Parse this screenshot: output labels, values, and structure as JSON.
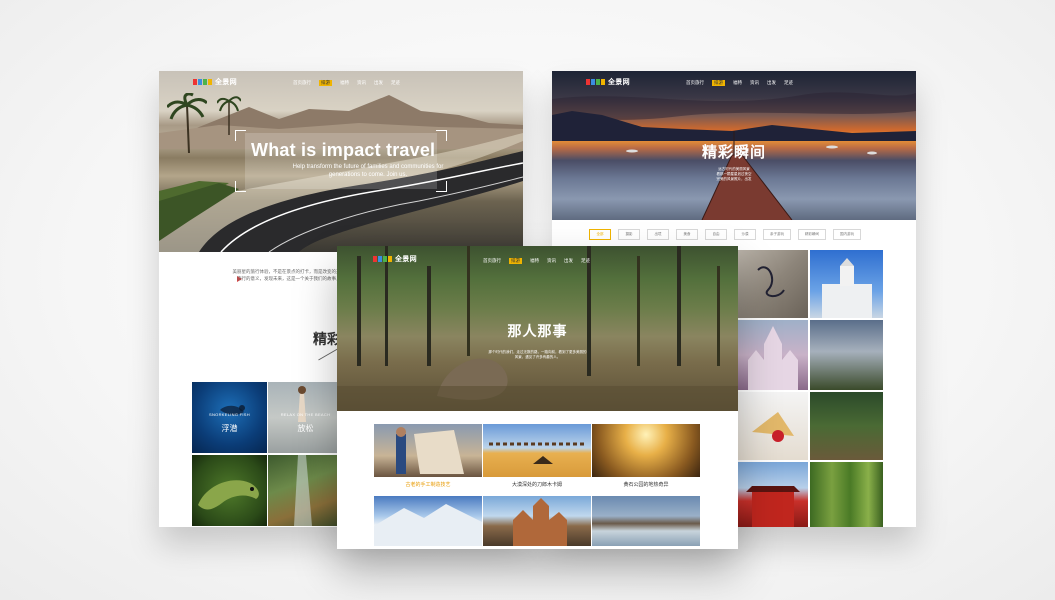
{
  "nav": {
    "logo_text": "全景网",
    "links": [
      "首页旅行",
      "排游",
      "福特",
      "资讯",
      "出发",
      "足迹"
    ]
  },
  "left_page": {
    "hero_title": "What is impact travel",
    "hero_subtitle": "Help transform the future of families and communities for generations to come. Join us.",
    "intro_text": "美丽星的旅行体验，不是在景点的打卡，而是改变的开始。我们想用我们的方式找到旅行的意义，发现未来，这是一个关于我们的故事，也许你会之后想起这一次的旅行。",
    "section_heading": "精彩",
    "tiles": [
      {
        "small": "SNORKELING FISH",
        "big": "浮潜"
      },
      {
        "small": "RELAX ON THE BEACH",
        "big": "放松"
      }
    ]
  },
  "right_page": {
    "hero_title": "精彩瞬间",
    "hero_subtitle": "远古时代的美丽风景\n看那一颗星星划过夜空\n完美的风景照片，出发",
    "tabs": [
      "全部",
      "摄影",
      "出境",
      "美食",
      "自由",
      "沙漠",
      "亲子游玩",
      "精彩瞬间",
      "国内游玩"
    ],
    "active_tab": 0
  },
  "front_page": {
    "hero_title": "那人那事",
    "hero_subtitle": "那个时代的我们，走过无数的路，一路向前，看到了更多美丽的风景，遇见了许多有趣的人。",
    "stories": [
      {
        "caption": "古老的手工制造技艺",
        "highlight": true
      },
      {
        "caption": "大漠深处的刀郎木卡姆",
        "highlight": false
      },
      {
        "caption": "黄石公园的地热奇异",
        "highlight": false
      }
    ]
  },
  "colors": {
    "accent": "#f0b400",
    "highlight_text": "#e89a00",
    "background": "#f4f4f4"
  }
}
